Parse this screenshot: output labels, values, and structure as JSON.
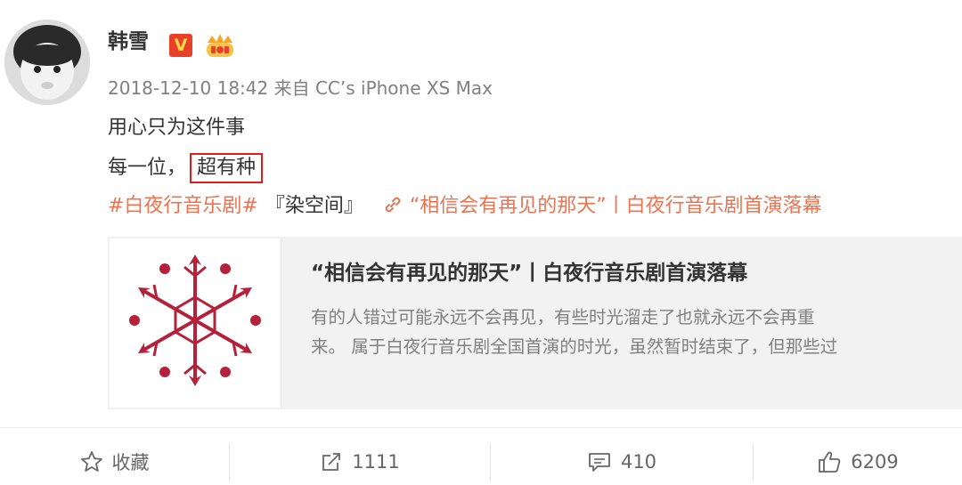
{
  "post": {
    "username": "韩雪",
    "verified_badge": "V",
    "timestamp": "2018-12-10 18:42",
    "source": "来自 CC’s iPhone XS Max",
    "line1": "用心只为这件事",
    "line2_prefix": "每一位，",
    "line2_highlight": "超有种",
    "hashtag": "#白夜行音乐剧#",
    "bracket_text": "『染空间』",
    "link_text": "“相信会有再见的那天”丨白夜行音乐剧首演落幕"
  },
  "card": {
    "title": "“相信会有再见的那天”丨白夜行音乐剧首演落幕",
    "desc_line1": "有的人错过可能永远不会再见，有些时光溜走了也就永远不会再重",
    "desc_line2": "来。 属于白夜行音乐剧全国首演的时光，虽然暂时结束了，但那些过"
  },
  "actions": {
    "favorite_label": "收藏",
    "repost_count": "1111",
    "comment_count": "410",
    "like_count": "6209"
  },
  "colors": {
    "link": "#eb7350",
    "highlight_border": "#e21c1c",
    "badge_red": "#e9402c",
    "thumb_red": "#b5213a"
  },
  "icons": [
    "star-icon",
    "repost-icon",
    "comment-icon",
    "thumbs-up-icon",
    "link-icon",
    "crown-badge-icon",
    "verified-icon"
  ]
}
